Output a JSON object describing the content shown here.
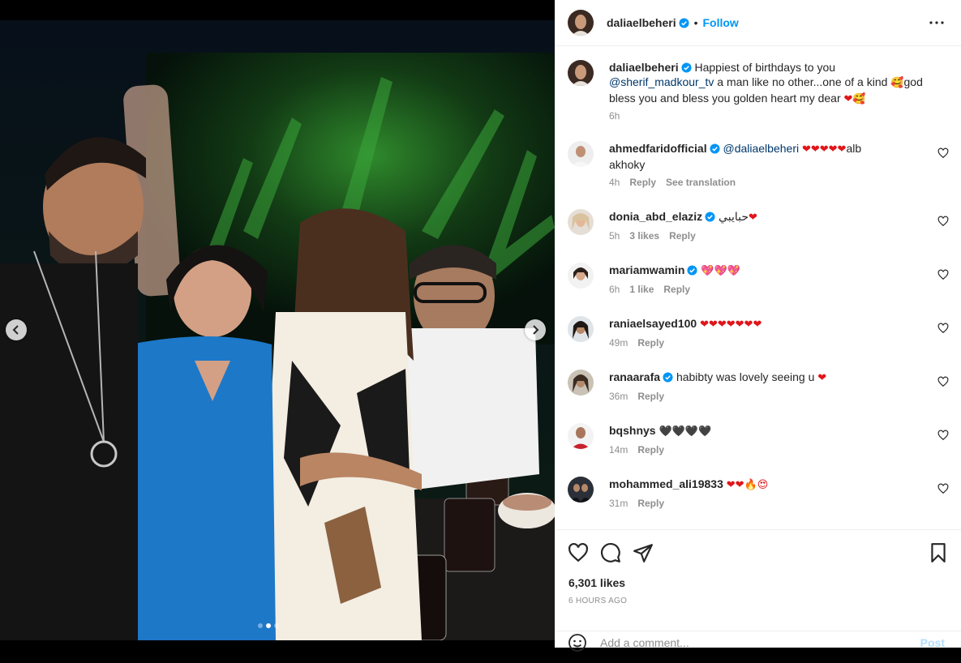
{
  "post": {
    "author": "daliaelbeheri",
    "separator": "•",
    "follow_label": "Follow",
    "caption": {
      "username": "daliaelbeheri",
      "text_1": "Happiest of birthdays to you",
      "mention": "@sherif_madkour_tv",
      "text_2": "a man like no other...one of a kind",
      "text_3": "god",
      "text_4": "bless you and bless you golden heart my dear",
      "time": "6h"
    },
    "likes": "6,301 likes",
    "posted_ago": "6 HOURS AGO",
    "carousel": {
      "slides": 3,
      "active": 2
    }
  },
  "comments": [
    {
      "username": "ahmedfaridofficial",
      "verified": true,
      "mention": "@daliaelbeheri",
      "emojis": "❤❤❤❤❤",
      "text": "alb",
      "text_2": "akhoky",
      "time": "4h",
      "likes": "",
      "reply": "Reply",
      "translate": "See translation"
    },
    {
      "username": "donia_abd_elaziz",
      "verified": true,
      "text": "حبايبي",
      "emojis": "❤",
      "time": "5h",
      "likes": "3 likes",
      "reply": "Reply"
    },
    {
      "username": "mariamwamin",
      "verified": true,
      "emojis": "💖💖💖",
      "time": "6h",
      "likes": "1 like",
      "reply": "Reply"
    },
    {
      "username": "raniaelsayed100",
      "verified": false,
      "emojis": "❤❤❤❤❤❤❤",
      "time": "49m",
      "likes": "",
      "reply": "Reply"
    },
    {
      "username": "ranaarafa",
      "verified": true,
      "text": "habibty was lovely seeing u",
      "emojis": "❤",
      "time": "36m",
      "likes": "",
      "reply": "Reply"
    },
    {
      "username": "bqshnys",
      "verified": false,
      "emojis": "🖤🖤🖤🖤",
      "time": "14m",
      "likes": "",
      "reply": "Reply"
    },
    {
      "username": "mohammed_ali19833",
      "verified": false,
      "emojis": "❤❤🔥😍",
      "time": "31m",
      "likes": "",
      "reply": "Reply"
    }
  ],
  "composer": {
    "placeholder": "Add a comment...",
    "post_label": "Post"
  },
  "colors": {
    "accent": "#0095f6",
    "verified": "#0095f6",
    "heart": "#e0151a",
    "muted": "#8e8e8e"
  }
}
